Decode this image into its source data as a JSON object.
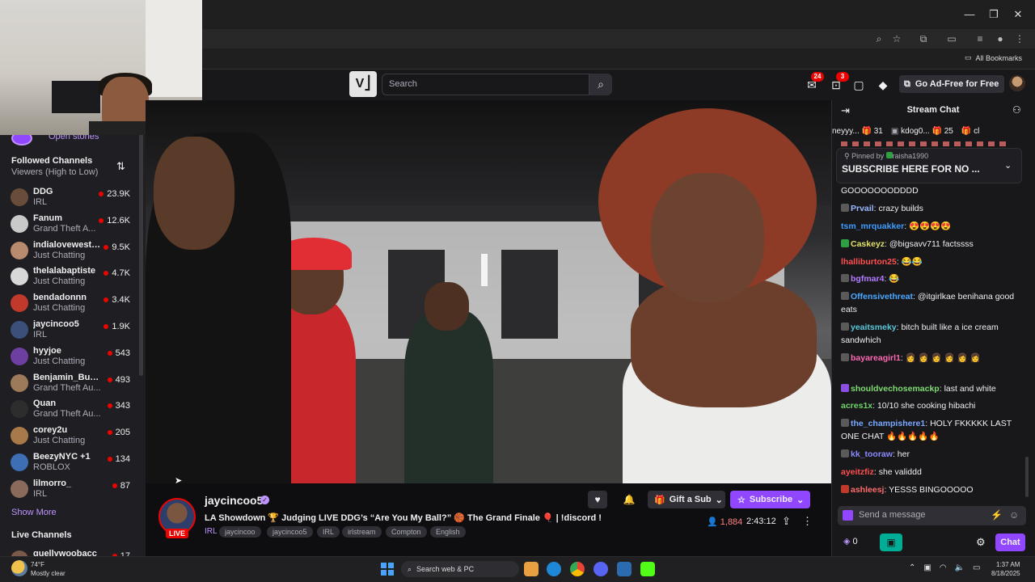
{
  "browser": {
    "bookmarks_label": "All Bookmarks"
  },
  "topnav": {
    "search_placeholder": "Search",
    "notifications_count": "24",
    "inbox_count": "3",
    "adfree_label": "Go Ad-Free for Free"
  },
  "sidebar": {
    "open_stories": "Open stories",
    "followed_heading": "Followed Channels",
    "followed_sort": "Viewers (High to Low)",
    "channels": [
      {
        "name": "DDG",
        "game": "IRL",
        "viewers": "23.9K",
        "color": "#6a4c3b"
      },
      {
        "name": "Fanum",
        "game": "Grand Theft A...",
        "viewers": "12.6K",
        "color": "#c9c9c9"
      },
      {
        "name": "indialovewestb...",
        "game": "Just Chatting",
        "viewers": "9.5K",
        "color": "#b88a6e"
      },
      {
        "name": "thelalabaptiste",
        "game": "Just Chatting",
        "viewers": "4.7K",
        "color": "#d8d8d8"
      },
      {
        "name": "bendadonnn",
        "game": "Just Chatting",
        "viewers": "3.4K",
        "color": "#c0392b"
      },
      {
        "name": "jaycincoo5",
        "game": "IRL",
        "viewers": "1.9K",
        "color": "#3a4f7a"
      },
      {
        "name": "hyyjoe",
        "game": "Just Chatting",
        "viewers": "543",
        "color": "#6c3fa0"
      },
      {
        "name": "Benjamin_Bucks",
        "game": "Grand Theft Au...",
        "viewers": "493",
        "color": "#9c7a5a"
      },
      {
        "name": "Quan",
        "game": "Grand Theft Au...",
        "viewers": "343",
        "color": "#2d2d2d"
      },
      {
        "name": "corey2u",
        "game": "Just Chatting",
        "viewers": "205",
        "color": "#a87a4a"
      },
      {
        "name": "BeezyNYC +1",
        "game": "ROBLOX",
        "viewers": "134",
        "color": "#3d6fb5"
      },
      {
        "name": "lilmorro_",
        "game": "IRL",
        "viewers": "87",
        "color": "#8a6a5a"
      }
    ],
    "show_more": "Show More",
    "live_heading": "Live Channels",
    "live_partial": {
      "name": "quellywoobacc",
      "viewers": "17"
    }
  },
  "stream": {
    "name": "jaycincoo5",
    "live_label": "LIVE",
    "title": "LA Showdown 🏆 Judging LIVE DDG’s “Are You My Ball?” 🏀 The Grand Finale 🎈 | !discord !sub",
    "category": "IRL",
    "tags": [
      "jaycincoo",
      "jaycincoo5",
      "IRL",
      "irlstream",
      "Compton",
      "English"
    ],
    "gift_label": "Gift a Sub",
    "subscribe_label": "Subscribe",
    "viewers": "1,884",
    "uptime": "2:43:12"
  },
  "chat": {
    "title": "Stream Chat",
    "gifters": [
      {
        "name": "neyyy...",
        "count": "31"
      },
      {
        "name": "kdog0...",
        "count": "25"
      },
      {
        "name": "cl",
        "count": ""
      }
    ],
    "pinned_by_label": "Pinned by",
    "pinned_by_user": "raisha1990",
    "pinned_text": "SUBSCRIBE HERE FOR NO ...",
    "messages": [
      {
        "user": "",
        "text": "GOOOOOOODDDD",
        "color": "#efeff1",
        "badge": ""
      },
      {
        "user": "Prvail",
        "text": "crazy builds",
        "color": "#9bb8ff",
        "badge": "#5a5a5a"
      },
      {
        "user": "tsm_mrquakker",
        "text": "😍😍😍😍",
        "color": "#3c9dff",
        "badge": ""
      },
      {
        "user": "Caskeyz",
        "text": "@bigsavv711  factssss",
        "color": "#e0e066",
        "badge": "#2ea043"
      },
      {
        "user": "lhalliburton25",
        "text": "😂😂",
        "color": "#ff4f4f",
        "badge": ""
      },
      {
        "user": "bgfmar4",
        "text": "😂",
        "color": "#b57cff",
        "badge": "#5a5a5a"
      },
      {
        "user": "Offensivethreat",
        "text": "@itgirlkae benihana good eats",
        "color": "#4aa8ff",
        "badge": "#5a5a5a"
      },
      {
        "user": "yeaitsmeky",
        "text": "bitch built like a ice cream sandwhich",
        "color": "#58c7d8",
        "badge": "#5a5a5a"
      },
      {
        "user": "bayareagirl1",
        "text": "👩 👩 👩 👩 👩 👩",
        "color": "#ff69b4",
        "badge": "#5a5a5a"
      },
      {
        "user": "shouldvechosemackp",
        "text": "last and white",
        "color": "#7fdc70",
        "badge": "#8a4fe0"
      },
      {
        "user": "acres1x",
        "text": "10/10 she cooking hibachi",
        "color": "#6fd26a",
        "badge": ""
      },
      {
        "user": "the_champishere1",
        "text": "HOLY FKKKKK LAST ONE CHAT 🔥🔥🔥🔥🔥",
        "color": "#7aa8ff",
        "badge": "#5a5a5a"
      },
      {
        "user": "kk_tooraw",
        "text": "her",
        "color": "#8a8aff",
        "badge": "#5a5a5a"
      },
      {
        "user": "ayeitzfiz",
        "text": "she validdd",
        "color": "#ff4f4f",
        "badge": ""
      },
      {
        "user": "ashleesj",
        "text": "YESSS BINGOOOOO",
        "color": "#ff6b6b",
        "badge": "#c0392b"
      }
    ],
    "input_placeholder": "Send a message",
    "points": "0",
    "chat_button": "Chat"
  },
  "taskbar": {
    "temperature": "74°F",
    "weather": "Mostly clear",
    "search_label": "Search web & PC",
    "time": "1:37 AM",
    "date": "8/18/2025"
  }
}
